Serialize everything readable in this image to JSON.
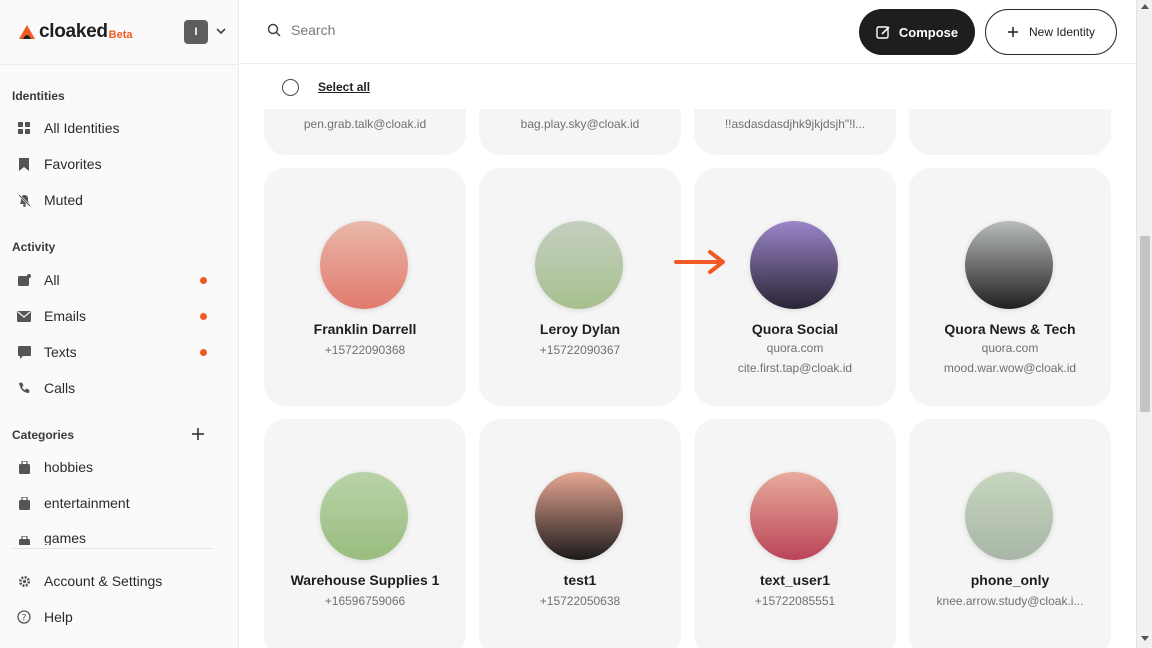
{
  "brand": {
    "name": "cloaked",
    "badge": "Beta",
    "accent": "#f15a24"
  },
  "account": {
    "initial": "I"
  },
  "search": {
    "placeholder": "Search"
  },
  "toolbar": {
    "compose_label": "Compose",
    "new_identity_label": "New Identity",
    "select_all_label": "Select all"
  },
  "sidebar": {
    "identities_heading": "Identities",
    "identities": [
      {
        "label": "All Identities",
        "icon": "grid-icon"
      },
      {
        "label": "Favorites",
        "icon": "bookmark-icon"
      },
      {
        "label": "Muted",
        "icon": "bell-off-icon"
      }
    ],
    "activity_heading": "Activity",
    "activity": [
      {
        "label": "All",
        "icon": "inbox-icon",
        "unread": true
      },
      {
        "label": "Emails",
        "icon": "mail-icon",
        "unread": true
      },
      {
        "label": "Texts",
        "icon": "chat-icon",
        "unread": true
      },
      {
        "label": "Calls",
        "icon": "phone-icon",
        "unread": false
      }
    ],
    "categories_heading": "Categories",
    "categories": [
      {
        "label": "hobbies"
      },
      {
        "label": "entertainment"
      },
      {
        "label": "games"
      }
    ],
    "footer": [
      {
        "label": "Account & Settings",
        "icon": "gear-icon"
      },
      {
        "label": "Help",
        "icon": "help-icon"
      }
    ]
  },
  "cards_partial": [
    {
      "line": "pen.grab.talk@cloak.id"
    },
    {
      "line": "bag.play.sky@cloak.id"
    },
    {
      "line": "!!asdasdasdjhk9jkjdsjh\"!l..."
    },
    {
      "line": ""
    }
  ],
  "cards": [
    {
      "name": "Franklin Darrell",
      "line1": "+15722090368",
      "line2": "",
      "gradient": [
        "#e8b8a8",
        "#e27a6e"
      ]
    },
    {
      "name": "Leroy Dylan",
      "line1": "+15722090367",
      "line2": "",
      "gradient": [
        "#c4cfc0",
        "#a7c08e"
      ]
    },
    {
      "name": "Quora Social",
      "line1": "quora.com",
      "line2": "cite.first.tap@cloak.id",
      "gradient": [
        "#9b86c9",
        "#2a2436"
      ]
    },
    {
      "name": "Quora News & Tech",
      "line1": "quora.com",
      "line2": "mood.war.wow@cloak.id",
      "gradient": [
        "#b9bcbc",
        "#202020"
      ]
    },
    {
      "name": "Warehouse Supplies 1",
      "line1": "+16596759066",
      "line2": "",
      "gradient": [
        "#b9d3a9",
        "#98bd7e"
      ]
    },
    {
      "name": "test1",
      "line1": "+15722050638",
      "line2": "",
      "gradient": [
        "#e6a793",
        "#1c1a1a"
      ]
    },
    {
      "name": "text_user1",
      "line1": "+15722085551",
      "line2": "",
      "gradient": [
        "#e8ab9c",
        "#b94558"
      ]
    },
    {
      "name": "phone_only",
      "line1": "knee.arrow.study@cloak.i...",
      "line2": "",
      "gradient": [
        "#c7d6bf",
        "#a8b6a6"
      ]
    }
  ]
}
